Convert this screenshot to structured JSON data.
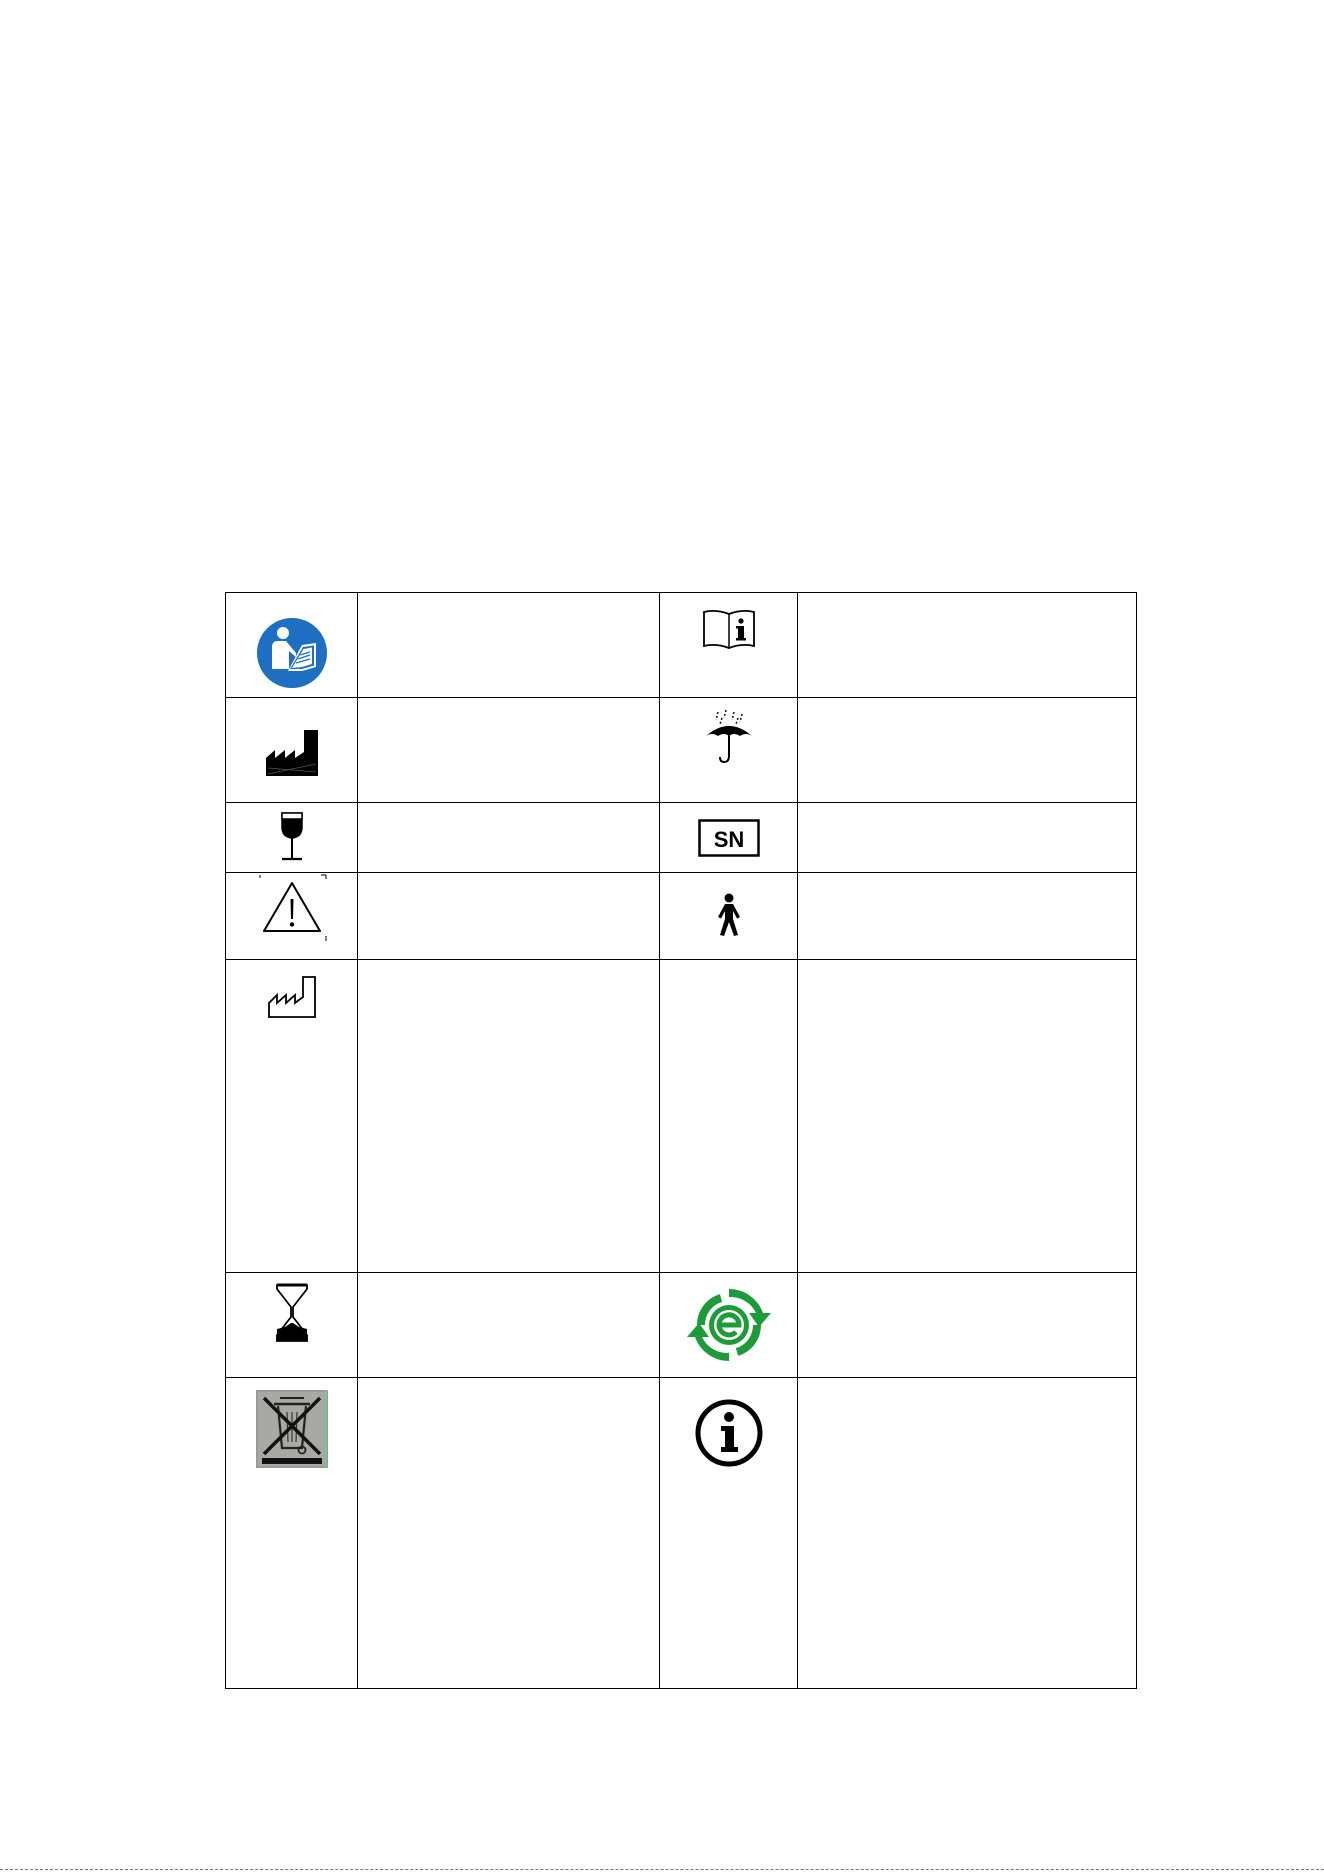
{
  "symbols_table": {
    "rows": [
      {
        "left": {
          "icon": "read-manual-icon",
          "text": ""
        },
        "right": {
          "icon": "instructions-info-icon",
          "text": ""
        }
      },
      {
        "left": {
          "icon": "manufacturer-icon",
          "text": ""
        },
        "right": {
          "icon": "keep-dry-icon",
          "text": ""
        }
      },
      {
        "left": {
          "icon": "fragile-icon",
          "text": ""
        },
        "right": {
          "icon": "serial-number-icon",
          "text": ""
        }
      },
      {
        "left": {
          "icon": "caution-icon",
          "text": ""
        },
        "right": {
          "icon": "type-b-applied-part-icon",
          "text": ""
        }
      },
      {
        "left": {
          "icon": "date-of-manufacture-icon",
          "text": ""
        },
        "right": {
          "icon": "",
          "text": ""
        }
      },
      {
        "left": {
          "icon": "use-by-date-icon",
          "text": ""
        },
        "right": {
          "icon": "environment-friendly-use-period-icon",
          "text": ""
        }
      },
      {
        "left": {
          "icon": "weee-disposal-icon",
          "text": ""
        },
        "right": {
          "icon": "information-icon",
          "text": ""
        }
      }
    ],
    "labels": {
      "serial_number": "SN"
    },
    "colors": {
      "manual_blue": "#1e6fc2",
      "eco_green": "#1e9a3a"
    }
  }
}
